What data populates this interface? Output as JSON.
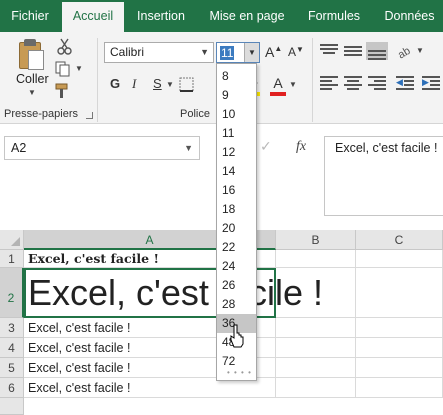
{
  "ribbon_tabs": [
    {
      "label": "Fichier"
    },
    {
      "label": "Accueil"
    },
    {
      "label": "Insertion"
    },
    {
      "label": "Mise en page"
    },
    {
      "label": "Formules"
    },
    {
      "label": "Données"
    }
  ],
  "clipboard": {
    "paste_label": "Coller",
    "group_label": "Presse-papiers"
  },
  "font": {
    "name": "Calibri",
    "size": "11",
    "group_label": "Police",
    "grow_label": "A",
    "shrink_label": "A",
    "bold_label": "G",
    "italic_label": "I",
    "underline_label": "S",
    "color_letter": "A",
    "font_color": "#e02020",
    "fill_color": "#ffeb00"
  },
  "size_options": [
    "8",
    "9",
    "10",
    "11",
    "12",
    "14",
    "16",
    "18",
    "20",
    "22",
    "24",
    "26",
    "28",
    "36",
    "48",
    "72"
  ],
  "hovered_size": "36",
  "formula_bar": {
    "name_box": "A2",
    "fx_label": "fx",
    "content": "Excel, c'est facile !"
  },
  "grid": {
    "columns": [
      "A",
      "B",
      "C"
    ],
    "rows": [
      "1",
      "2",
      "3",
      "4",
      "5",
      "6"
    ],
    "cells": {
      "a1": "Excel, c'est facile !",
      "a2": "Excel, c'est facile !",
      "a3": "Excel, c'est facile !",
      "a4": "Excel, c'est facile !",
      "a5": "Excel, c'est facile !",
      "a6": "Excel, c'est facile !"
    },
    "selected_cell": "A2"
  },
  "colors": {
    "ribbon_green": "#217346",
    "selection_green": "#217346"
  }
}
